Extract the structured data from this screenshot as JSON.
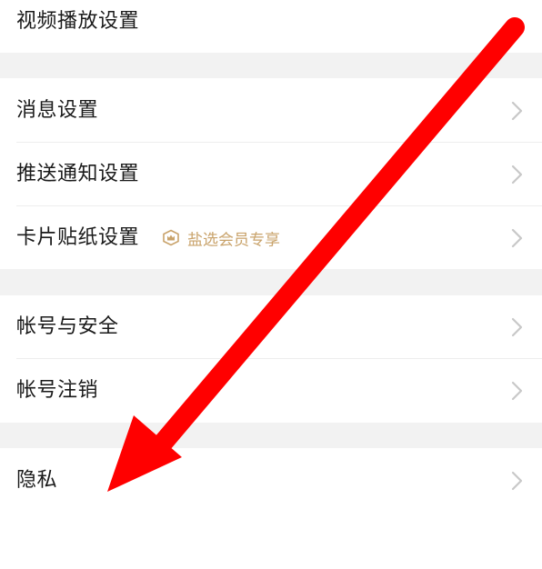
{
  "settings": {
    "video_playback": "视频播放设置",
    "messages": "消息设置",
    "push_notifications": "推送通知设置",
    "card_stickers": "卡片贴纸设置",
    "member_badge": "盐选会员专享",
    "account_security": "帐号与安全",
    "account_cancel": "帐号注销",
    "privacy": "隐私"
  },
  "colors": {
    "arrow": "#ff0000",
    "badge": "#c9a36b",
    "section_gap": "#f2f2f2",
    "chevron": "#c8c8c8"
  },
  "icons": {
    "row_indicator": "chevron-right-icon",
    "member_badge": "crown-shield-icon",
    "annotation": "red-arrow-annotation"
  }
}
